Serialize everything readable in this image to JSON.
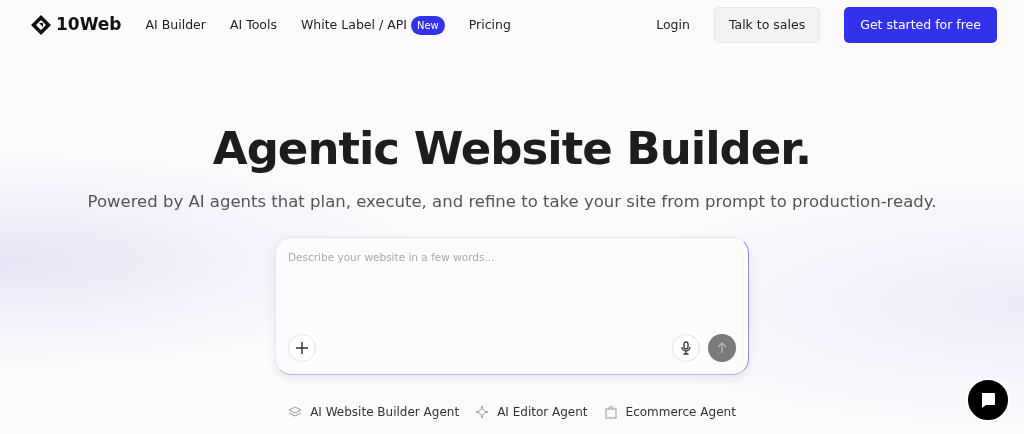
{
  "brand": {
    "name": "10Web"
  },
  "nav": [
    {
      "label": "AI Builder"
    },
    {
      "label": "AI Tools"
    },
    {
      "label": "White Label / API",
      "badge": "New"
    },
    {
      "label": "Pricing"
    }
  ],
  "actions": [
    {
      "label": "Login",
      "kind": "link"
    },
    {
      "label": "Talk to sales",
      "kind": "secondary"
    },
    {
      "label": "Get started for free",
      "kind": "primary"
    }
  ],
  "hero": {
    "title": "Agentic Website Builder.",
    "subtitle": "Powered by AI agents that plan, execute, and refine to take your site from prompt to production-ready."
  },
  "prompt": {
    "placeholder": "Describe your website in a few words...",
    "send_disabled": true
  },
  "agents": [
    {
      "label": "AI Website Builder Agent",
      "kind": "layers"
    },
    {
      "label": "AI Editor Agent",
      "kind": "sparkle"
    },
    {
      "label": "Ecommerce Agent",
      "kind": "bag"
    }
  ]
}
